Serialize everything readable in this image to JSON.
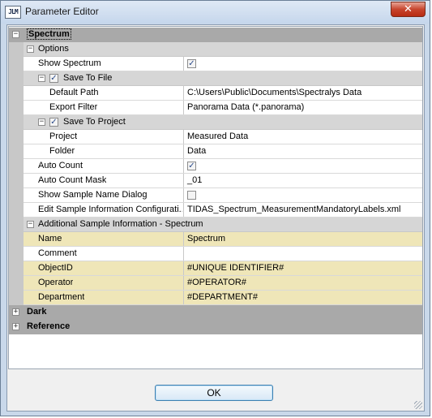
{
  "window": {
    "title": "Parameter Editor",
    "icon_text": "JLM",
    "close_label": "✕"
  },
  "icons": {
    "collapse": "−",
    "expand": "+",
    "check": "✓"
  },
  "grid": {
    "spectrum": "Spectrum",
    "options": "Options",
    "show_spectrum": "Show Spectrum",
    "save_to_file": "Save To File",
    "default_path": {
      "name": "Default Path",
      "value": "C:\\Users\\Public\\Documents\\Spectralys Data"
    },
    "export_filter": {
      "name": "Export Filter",
      "value": "Panorama Data (*.panorama)"
    },
    "save_to_project": "Save To Project",
    "project": {
      "name": "Project",
      "value": "Measured Data"
    },
    "folder": {
      "name": "Folder",
      "value": "Data"
    },
    "auto_count": "Auto Count",
    "auto_count_mask": {
      "name": "Auto Count Mask",
      "value": "_01"
    },
    "show_sample_name_dialog": "Show Sample Name Dialog",
    "edit_sample_info": {
      "name": "Edit Sample Information Configurati...",
      "value": "TIDAS_Spectrum_MeasurementMandatoryLabels.xml"
    },
    "additional_info": "Additional Sample Information - Spectrum",
    "name_row": {
      "name": "Name",
      "value": "Spectrum"
    },
    "comment_row": {
      "name": "Comment",
      "value": ""
    },
    "objectid_row": {
      "name": "ObjectID",
      "value": "#UNIQUE IDENTIFIER#"
    },
    "operator_row": {
      "name": "Operator",
      "value": "#OPERATOR#"
    },
    "department_row": {
      "name": "Department",
      "value": "#DEPARTMENT#"
    },
    "dark": "Dark",
    "reference": "Reference"
  },
  "checkboxes": {
    "show_spectrum": true,
    "save_to_file": true,
    "save_to_project": true,
    "auto_count": true,
    "show_sample_name_dialog": false
  },
  "footer": {
    "ok_label": "OK"
  }
}
